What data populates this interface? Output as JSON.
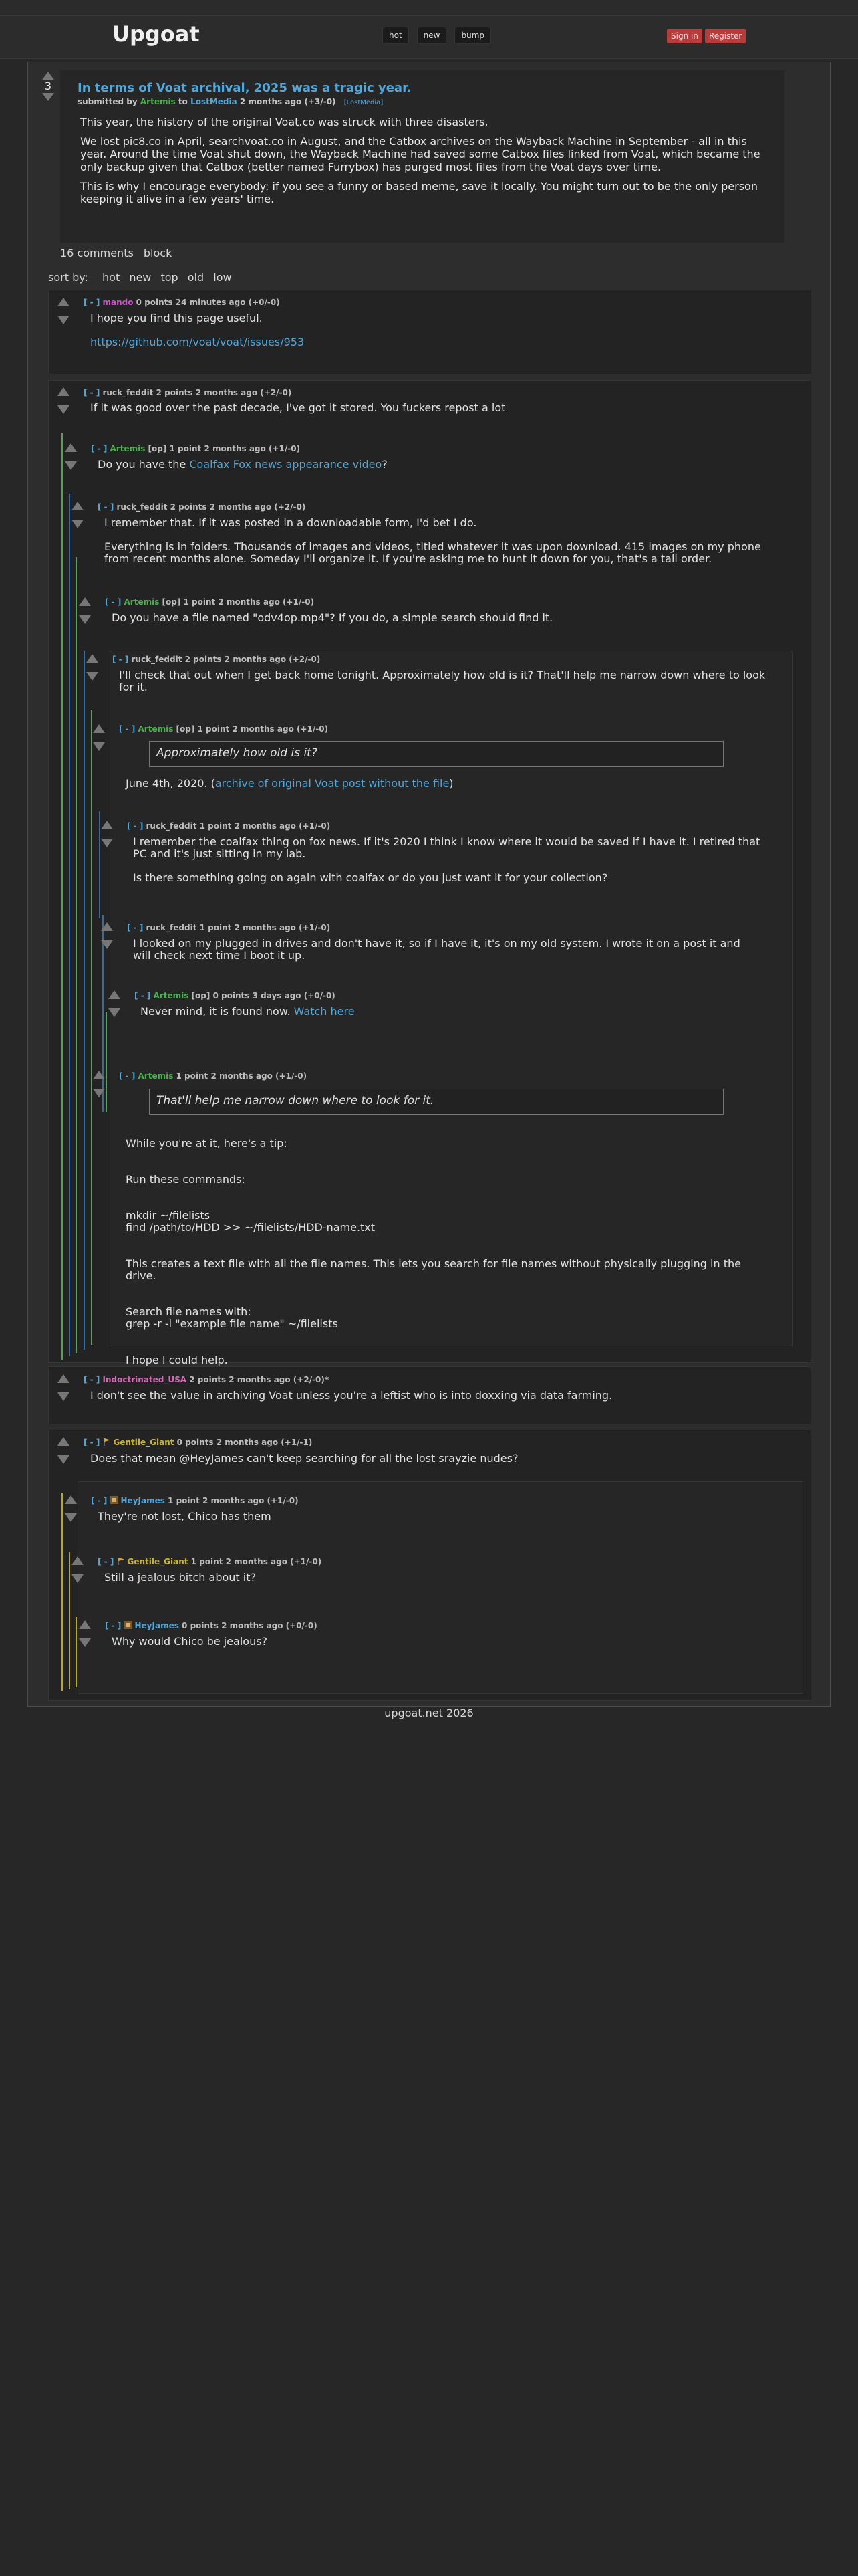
{
  "header": {
    "logo": "Upgoat",
    "nav": [
      "hot",
      "new",
      "bump"
    ],
    "sign_in": "Sign in",
    "register": "Register"
  },
  "post": {
    "score": "3",
    "title": "In terms of Voat archival, 2025 was a tragic year.",
    "meta_prefix": "submitted by",
    "author": "Artemis",
    "meta_to": "to",
    "sub": "LostMedia",
    "meta_suffix": "2 months ago (+3/-0)",
    "flair": "[LostMedia]",
    "paragraphs": [
      "This year, the history of the original Voat.co was struck with three disasters.",
      "We lost pic8.co in April, searchvoat.co in August, and the Catbox archives on the Wayback Machine in September - all in this year. Around the time Voat shut down, the Wayback Machine had saved some Catbox files linked from Voat, which became the only backup given that Catbox (better named Furrybox) has purged most files from the Voat days over time.",
      "This is why I encourage everybody: if you see a funny or based meme, save it locally. You might turn out to be the only person keeping it alive in a few years' time."
    ],
    "comments_link": "16 comments",
    "block_link": "block"
  },
  "sort": {
    "label": "sort by:",
    "options": [
      "hot",
      "new",
      "top",
      "old",
      "low"
    ]
  },
  "comments": {
    "c1": {
      "toggle": "[ - ]",
      "user": "mando",
      "meta": "0 points 24 minutes ago (+0/-0)",
      "text": "I hope you find this page useful.",
      "link": "https://github.com/voat/voat/issues/953"
    },
    "c2": {
      "toggle": "[ - ]",
      "user": "ruck_feddit",
      "meta": "2 points 2 months ago (+2/-0)",
      "text": "If it was good over the past decade, I've got it stored. You fuckers repost a lot"
    },
    "c3": {
      "toggle": "[ - ]",
      "user": "Artemis",
      "op": "[op]",
      "meta": "1 point 2 months ago (+1/-0)",
      "pre": "Do you have the ",
      "link": "Coalfax Fox news appearance video",
      "post": "?"
    },
    "c4": {
      "toggle": "[ - ]",
      "user": "ruck_feddit",
      "meta": "2 points 2 months ago (+2/-0)",
      "p1": "I remember that. If it was posted in a downloadable form, I'd bet I do.",
      "p2": "Everything is in folders. Thousands of images and videos, titled whatever it was upon download. 415 images on my phone from recent months alone. Someday I'll organize it. If you're asking me to hunt it down for you, that's a tall order."
    },
    "c5": {
      "toggle": "[ - ]",
      "user": "Artemis",
      "op": "[op]",
      "meta": "1 point 2 months ago (+1/-0)",
      "text": "Do you have a file named \"odv4op.mp4\"? If you do, a simple search should find it."
    },
    "c6": {
      "toggle": "[ - ]",
      "user": "ruck_feddit",
      "meta": "2 points 2 months ago (+2/-0)",
      "text": "I'll check that out when I get back home tonight. Approximately how old is it? That'll help me narrow down where to look for it."
    },
    "c7": {
      "toggle": "[ - ]",
      "user": "Artemis",
      "op": "[op]",
      "meta": "1 point 2 months ago (+1/-0)",
      "quote": "Approximately how old is it?",
      "pre": "June 4th, 2020. (",
      "link": "archive of original Voat post without the file",
      "post": ")"
    },
    "c8": {
      "toggle": "[ - ]",
      "user": "ruck_feddit",
      "meta": "1 point 2 months ago (+1/-0)",
      "p1": "I remember the coalfax thing on fox news. If it's 2020 I think I know where it would be saved if I have it. I retired that PC and it's just sitting in my lab.",
      "p2": "Is there something going on again with coalfax or do you just want it for your collection?"
    },
    "c9": {
      "toggle": "[ - ]",
      "user": "ruck_feddit",
      "meta": "1 point 2 months ago (+1/-0)",
      "text": "I looked on my plugged in drives and don't have it, so if I have it, it's on my old system. I wrote it on a post it and will check next time I boot it up."
    },
    "c10": {
      "toggle": "[ - ]",
      "user": "Artemis",
      "op": "[op]",
      "meta": "0 points 3 days ago (+0/-0)",
      "pre": "Never mind, it is found now. ",
      "link": "Watch here"
    },
    "c11": {
      "toggle": "[ - ]",
      "user": "Artemis",
      "meta": "1 point 2 months ago (+1/-0)",
      "quote": "That'll help me narrow down where to look for it.",
      "lines": [
        "While you're at it, here's a tip:",
        "Run these commands:",
        "mkdir ~/filelists\nfind /path/to/HDD >> ~/filelists/HDD-name.txt",
        "This creates a text file with all the file names. This lets you search for file names without physically plugging in the drive.",
        "Search file names with:\ngrep -r -i \"example file name\" ~/filelists",
        "I hope I could help."
      ]
    },
    "c12": {
      "toggle": "[ - ]",
      "user": "Indoctrinated_USA",
      "meta": "2 points 2 months ago (+2/-0)*",
      "text": "I don't see the value in archiving Voat unless you're a leftist who is into doxxing via data farming."
    },
    "c13": {
      "toggle": "[ - ]",
      "user": "Gentile_Giant",
      "meta": "0 points 2 months ago (+1/-1)",
      "text": "Does that mean @HeyJames can't keep searching for all the lost srayzie nudes?"
    },
    "c14": {
      "toggle": "[ - ]",
      "user": "HeyJames",
      "meta": "1 point 2 months ago (+1/-0)",
      "text": "They're not lost, Chico has them"
    },
    "c15": {
      "toggle": "[ - ]",
      "user": "Gentile_Giant",
      "meta": "1 point 2 months ago (+1/-0)",
      "text": "Still a jealous bitch about it?"
    },
    "c16": {
      "toggle": "[ - ]",
      "user": "HeyJames",
      "meta": "0 points 2 months ago (+0/-0)",
      "text": "Why would Chico be jealous?"
    }
  },
  "footer": "upgoat.net 2026"
}
